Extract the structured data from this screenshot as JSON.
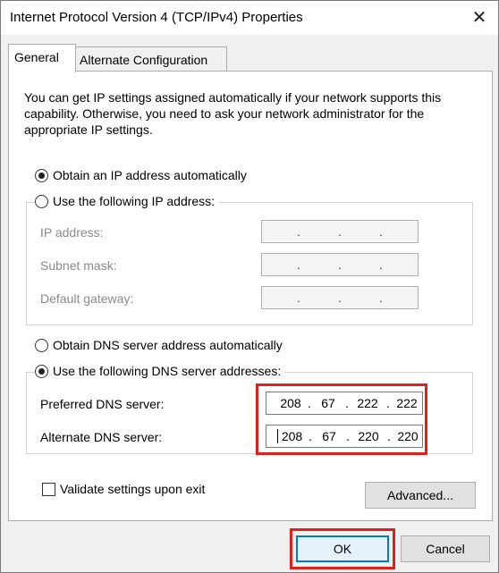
{
  "window": {
    "title": "Internet Protocol Version 4 (TCP/IPv4) Properties",
    "close_icon": "close-icon"
  },
  "tabs": [
    {
      "label": "General",
      "active": true
    },
    {
      "label": "Alternate Configuration",
      "active": false
    }
  ],
  "description": "You can get IP settings assigned automatically if your network supports this capability. Otherwise, you need to ask your network administrator for the appropriate IP settings.",
  "ip_settings": {
    "auto_label": "Obtain an IP address automatically",
    "manual_label": "Use the following IP address:",
    "selected": "auto",
    "fields": [
      {
        "label": "IP address:",
        "value": ". . ."
      },
      {
        "label": "Subnet mask:",
        "value": ". . ."
      },
      {
        "label": "Default gateway:",
        "value": ". . ."
      }
    ]
  },
  "dns_settings": {
    "auto_label": "Obtain DNS server address automatically",
    "manual_label": "Use the following DNS server addresses:",
    "selected": "manual",
    "preferred": {
      "label": "Preferred DNS server:",
      "octets": [
        "208",
        "67",
        "222",
        "222"
      ]
    },
    "alternate": {
      "label": "Alternate DNS server:",
      "octets": [
        "208",
        "67",
        "220",
        "220"
      ]
    }
  },
  "validate": {
    "label": "Validate settings upon exit",
    "checked": false
  },
  "buttons": {
    "advanced": "Advanced...",
    "ok": "OK",
    "cancel": "Cancel"
  },
  "colors": {
    "highlight": "#e0201b",
    "default_button_border": "#0078d7"
  }
}
